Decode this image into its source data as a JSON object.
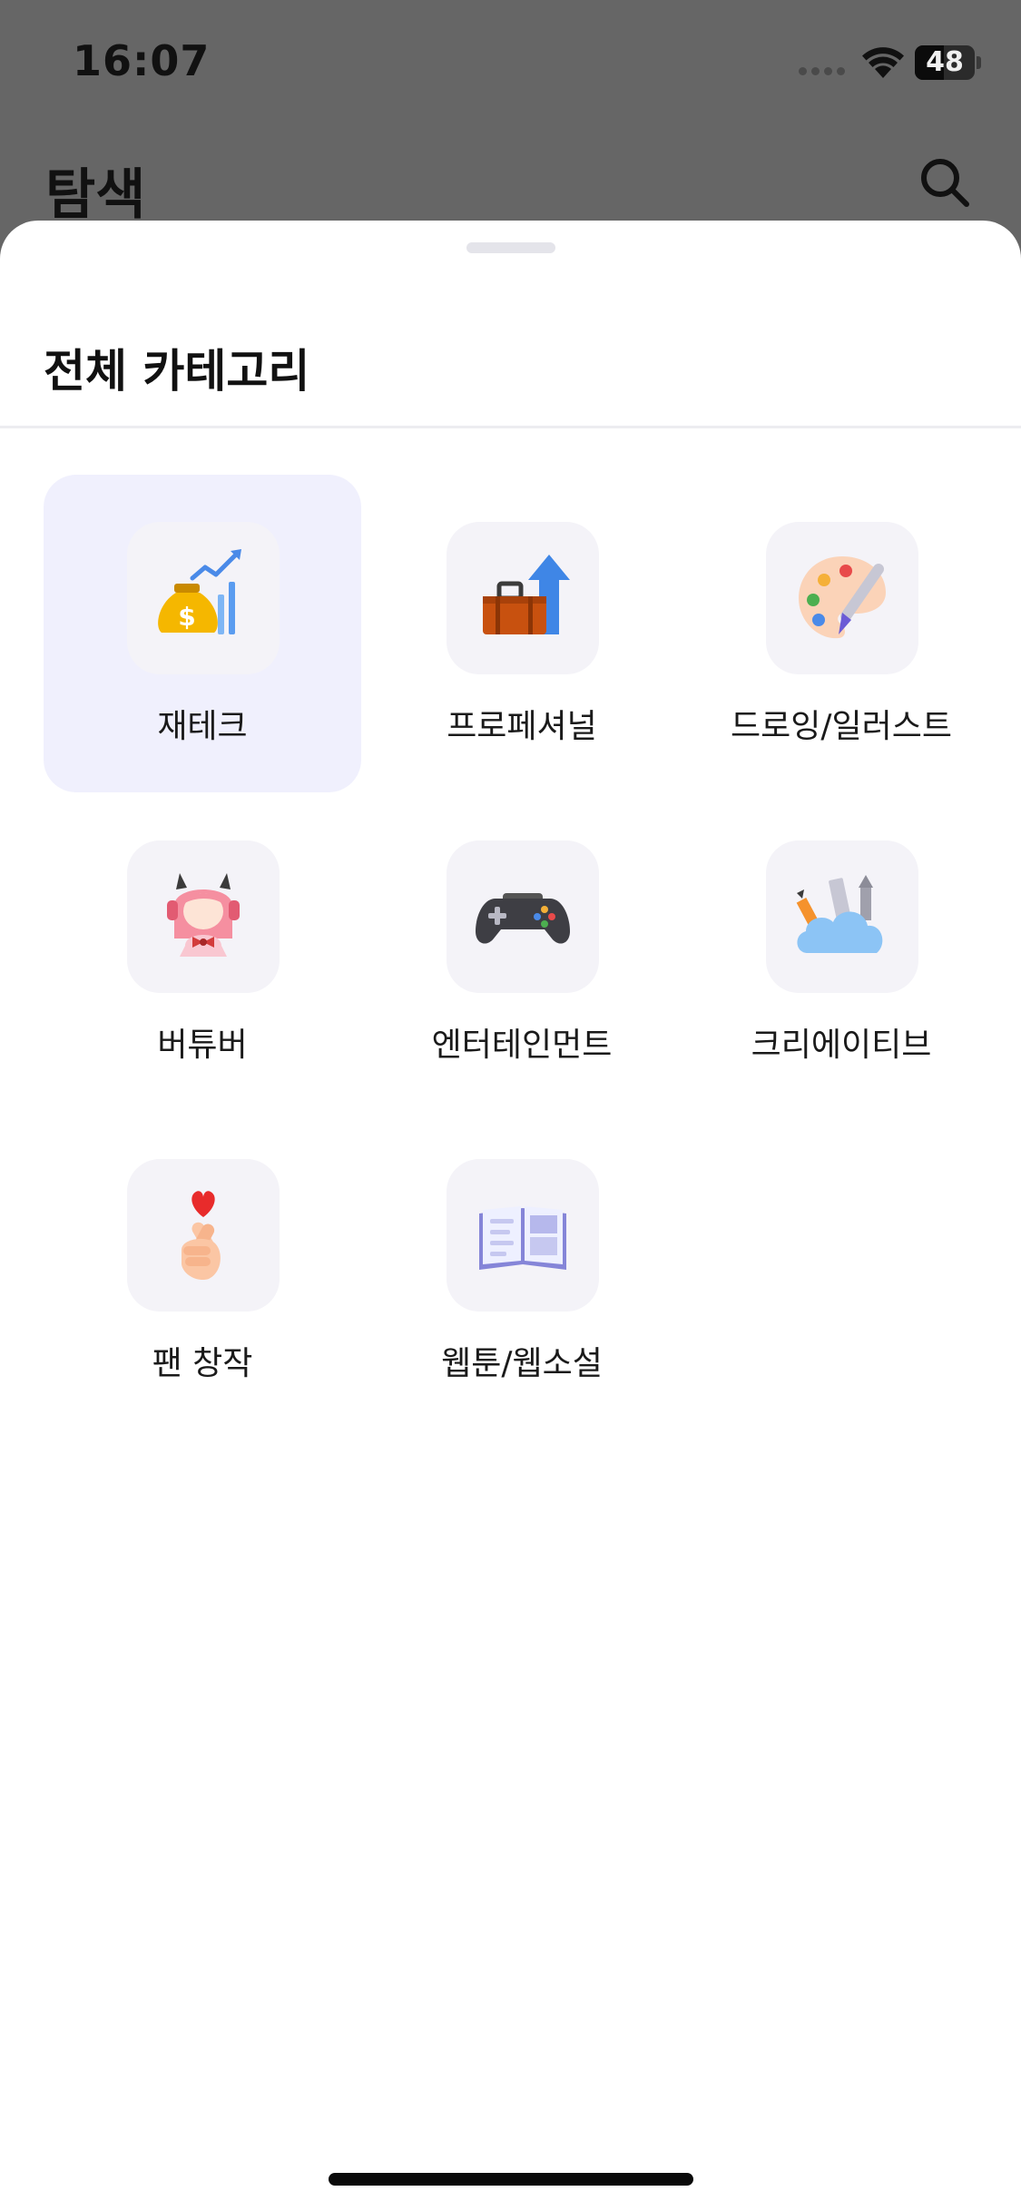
{
  "status_bar": {
    "time": "16:07",
    "battery_level": "48",
    "battery_fraction": 0.48
  },
  "background_page": {
    "title": "탐색",
    "search_icon": "search-icon"
  },
  "sheet": {
    "title": "전체 카테고리",
    "categories": [
      {
        "label": "재테크",
        "icon": "money-bag-growth-icon",
        "selected": true
      },
      {
        "label": "프로페셔널",
        "icon": "briefcase-arrow-icon",
        "selected": false
      },
      {
        "label": "드로잉/일러스트",
        "icon": "palette-brush-icon",
        "selected": false
      },
      {
        "label": "버튜버",
        "icon": "vtuber-character-icon",
        "selected": false
      },
      {
        "label": "엔터테인먼트",
        "icon": "game-controller-icon",
        "selected": false
      },
      {
        "label": "크리에이티브",
        "icon": "cloud-tools-icon",
        "selected": false
      },
      {
        "label": "팬 창작",
        "icon": "finger-heart-icon",
        "selected": false
      },
      {
        "label": "웹툰/웹소설",
        "icon": "open-book-icon",
        "selected": false
      }
    ]
  },
  "colors": {
    "selected_bg": "#f0f0fd",
    "icon_bg": "#f4f3f8",
    "backdrop": "#666666"
  }
}
